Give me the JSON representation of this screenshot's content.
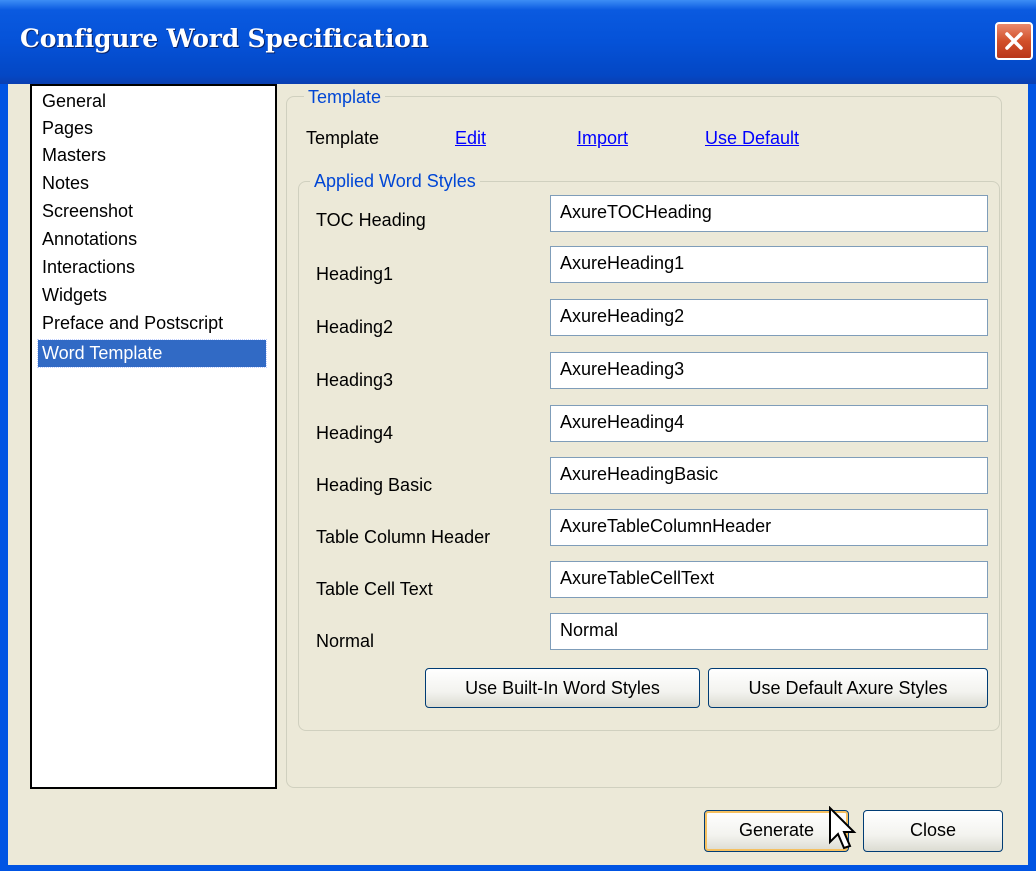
{
  "window": {
    "title": "Configure Word Specification"
  },
  "nav": {
    "items": [
      "General",
      "Pages",
      "Masters",
      "Notes",
      "Screenshot",
      "Annotations",
      "Interactions",
      "Widgets",
      "Preface and Postscript",
      "Word Template"
    ],
    "selected": "Word Template"
  },
  "template_group": {
    "title": "Template",
    "label": "Template",
    "edit_link": "Edit",
    "import_link": "Import",
    "use_default_link": "Use Default"
  },
  "styles_group": {
    "title": "Applied Word Styles",
    "rows": [
      {
        "label": "TOC Heading",
        "value": "AxureTOCHeading"
      },
      {
        "label": "Heading1",
        "value": "AxureHeading1"
      },
      {
        "label": "Heading2",
        "value": "AxureHeading2"
      },
      {
        "label": "Heading3",
        "value": "AxureHeading3"
      },
      {
        "label": "Heading4",
        "value": "AxureHeading4"
      },
      {
        "label": "Heading Basic",
        "value": "AxureHeadingBasic"
      },
      {
        "label": "Table Column Header",
        "value": "AxureTableColumnHeader"
      },
      {
        "label": "Table Cell Text",
        "value": "AxureTableCellText"
      },
      {
        "label": "Normal",
        "value": "Normal"
      }
    ],
    "use_builtin_label": "Use Built-In Word Styles",
    "use_default_axure_label": "Use Default Axure Styles"
  },
  "footer": {
    "generate_label": "Generate",
    "close_label": "Close"
  },
  "icons": {
    "close": "close-x-icon",
    "cursor": "mouse-pointer-icon"
  },
  "colors": {
    "titlebar": "#0552d8",
    "selection": "#316ac5",
    "link": "#0000ff",
    "group_title": "#0046d5"
  }
}
